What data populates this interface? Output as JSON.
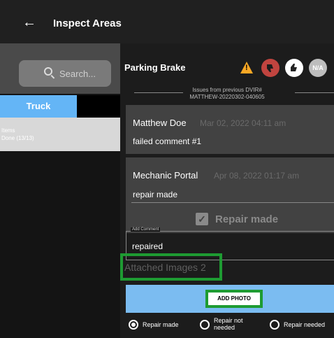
{
  "header": {
    "back_icon": "arrow-left-icon",
    "title": "Inspect Areas"
  },
  "sidebar": {
    "search_placeholder": "Search...",
    "tab_label": "Truck",
    "items_line1": "Items",
    "items_line2": "Done (13/13)"
  },
  "item": {
    "title": "Parking Brake",
    "warning_symbol": "!",
    "na_label": "N/A",
    "prev_issues_line1": "Issues from previous DVIR#",
    "prev_issues_line2": "MATTHEW-20220302-040605"
  },
  "comments": [
    {
      "author": "Matthew Doe",
      "date": "Mar 02, 2022 04:11 am",
      "text": "failed comment #1"
    },
    {
      "author": "Mechanic Portal",
      "date": "Apr 08, 2022 01:17 am",
      "text": "repair made",
      "repair_label": "Repair made",
      "repair_checked": true
    }
  ],
  "add_comment": {
    "label": "Add Comment",
    "value": "repaired"
  },
  "attached_images": "Attached Images 2",
  "add_photo_label": "ADD PHOTO",
  "repair_options": [
    {
      "label": "Repair made",
      "selected": true
    },
    {
      "label_line1": "Repair not",
      "label_line2": "needed",
      "selected": false
    },
    {
      "label": "Repair needed",
      "selected": false
    }
  ],
  "colors": {
    "accent_blue": "#64b5f6",
    "highlight_green": "#1e9b32",
    "warning": "#f9a825",
    "fail_red": "#c0443f"
  }
}
